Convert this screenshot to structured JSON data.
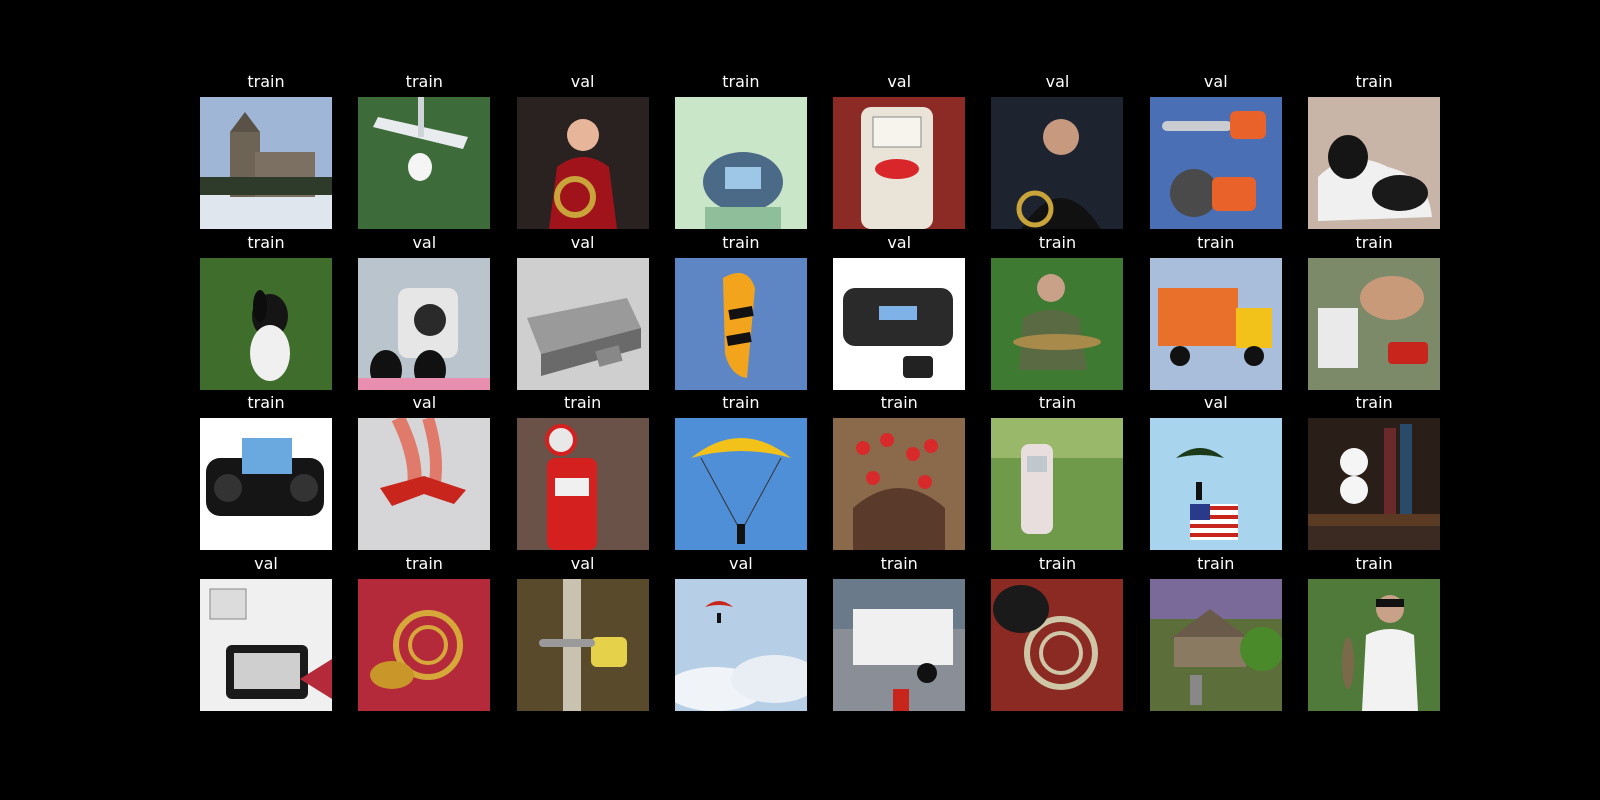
{
  "tiles": [
    {
      "label": "train",
      "subject": "church-in-snow",
      "bg": "#9fb6d6"
    },
    {
      "label": "train",
      "subject": "golf-putter-and-ball",
      "bg": "#3d6b3a"
    },
    {
      "label": "val",
      "subject": "woman-with-french-horn",
      "bg": "#2a2220"
    },
    {
      "label": "train",
      "subject": "cd-player",
      "bg": "#c9e6c9"
    },
    {
      "label": "val",
      "subject": "esso-gas-pump",
      "bg": "#8c2a26"
    },
    {
      "label": "val",
      "subject": "boy-playing-french-horn",
      "bg": "#1d2430"
    },
    {
      "label": "val",
      "subject": "chainsaw-and-saw",
      "bg": "#4a6fb5"
    },
    {
      "label": "train",
      "subject": "springer-spaniel-lying",
      "bg": "#c8b5a8"
    },
    {
      "label": "train",
      "subject": "springer-spaniel-on-grass",
      "bg": "#3f6d2c"
    },
    {
      "label": "val",
      "subject": "retro-cd-player",
      "bg": "#b9c4cc"
    },
    {
      "label": "val",
      "subject": "radio-alarm-clock",
      "bg": "#cfcfcf"
    },
    {
      "label": "train",
      "subject": "yellow-parachute",
      "bg": "#5f86c4"
    },
    {
      "label": "val",
      "subject": "portable-cd-player",
      "bg": "#ffffff"
    },
    {
      "label": "train",
      "subject": "man-with-fish",
      "bg": "#3f7a32"
    },
    {
      "label": "train",
      "subject": "garbage-truck",
      "bg": "#a8bedb"
    },
    {
      "label": "train",
      "subject": "man-with-chainsaw",
      "bg": "#7d8a6a"
    },
    {
      "label": "train",
      "subject": "boombox-with-screen",
      "bg": "#ffffff"
    },
    {
      "label": "val",
      "subject": "aerobatic-plane-smoke",
      "bg": "#d6d6d8"
    },
    {
      "label": "train",
      "subject": "red-gas-pump",
      "bg": "#6a5248"
    },
    {
      "label": "train",
      "subject": "parachutist-sky",
      "bg": "#4f8fd8"
    },
    {
      "label": "train",
      "subject": "roses-on-church-arch",
      "bg": "#8a6a4a"
    },
    {
      "label": "train",
      "subject": "old-gas-pump-garden",
      "bg": "#6f9a4a"
    },
    {
      "label": "val",
      "subject": "parachute-with-flag",
      "bg": "#a8d4ee"
    },
    {
      "label": "train",
      "subject": "golf-balls-on-shelf",
      "bg": "#3a2a22"
    },
    {
      "label": "val",
      "subject": "cassette-player",
      "bg": "#f0f0f0"
    },
    {
      "label": "train",
      "subject": "french-horn-on-red",
      "bg": "#b42a3a"
    },
    {
      "label": "val",
      "subject": "chainsaw-on-log",
      "bg": "#5a4a2c"
    },
    {
      "label": "val",
      "subject": "parachute-in-clouds",
      "bg": "#b6cfe6"
    },
    {
      "label": "train",
      "subject": "garbage-truck-street",
      "bg": "#8a8e96"
    },
    {
      "label": "train",
      "subject": "french-horn-on-rug",
      "bg": "#8a2a22"
    },
    {
      "label": "train",
      "subject": "stone-church-graveyard",
      "bg": "#5c6e3a"
    },
    {
      "label": "train",
      "subject": "man-holding-fish",
      "bg": "#4f7a3a"
    }
  ]
}
